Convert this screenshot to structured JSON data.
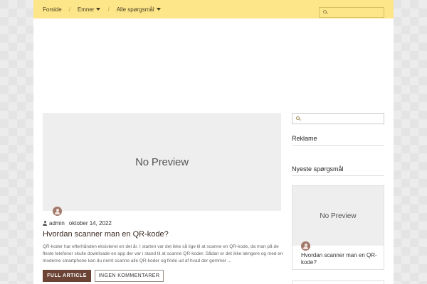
{
  "topbar": {
    "crumbs": [
      "Forside",
      "Emner",
      "Alle spørgsmål"
    ],
    "separator": "/"
  },
  "main_post": {
    "preview_text": "No Preview",
    "author": "admin",
    "date": "oktober 14, 2022",
    "title": "Hvordan scanner man en QR-kode?",
    "excerpt": "QR-koder har efterhånden eksisteret en del år. I starten var det ikke så lige til at scanne en QR-kode, da man på de fleste telefoner skulle downloade en app der var i stand til at scanne QR-koder. Sådan er det ikke længere og med en moderne smartphone kan du nemt scanne alle QR-koder og finde ud af hvad der gemmer ...",
    "full_button": "FULL ARTICLE",
    "comments_button": "INGEN KOMMENTARER"
  },
  "sidebar": {
    "reklame_heading": "Reklame",
    "newest_heading": "Nyeste spørgsmål",
    "card": {
      "preview_text": "No Preview",
      "title": "Hvordan scanner man en QR-kode?"
    }
  },
  "colors": {
    "topbar": "#fde58a",
    "button_primary": "#6b4436",
    "avatar": "#a0786a"
  }
}
